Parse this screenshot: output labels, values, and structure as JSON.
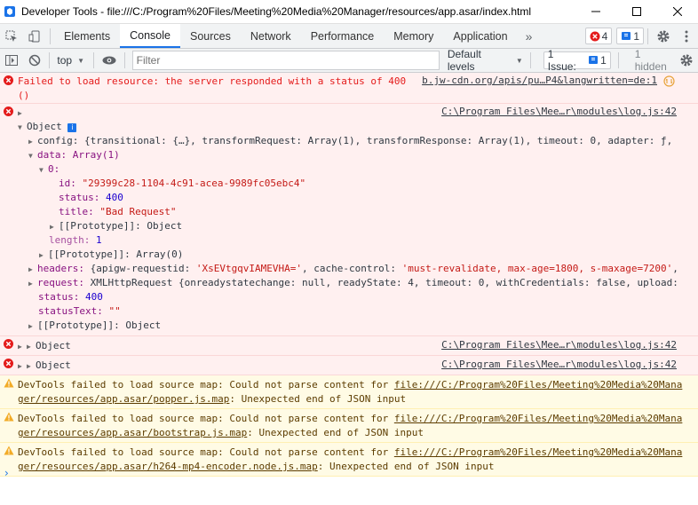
{
  "window": {
    "title": "Developer Tools - file:///C:/Program%20Files/Meeting%20Media%20Manager/resources/app.asar/index.html"
  },
  "tabs": [
    "Elements",
    "Console",
    "Sources",
    "Network",
    "Performance",
    "Memory",
    "Application"
  ],
  "badges": {
    "errors": "4",
    "info": "1"
  },
  "console_toolbar": {
    "context": "top",
    "filter_placeholder": "Filter",
    "levels": "Default levels",
    "issues_label": "1 Issue:",
    "issues_count": "1",
    "hidden": "1 hidden"
  },
  "messages": {
    "err1": {
      "text": "Failed to load resource: the server responded with a status of 400",
      "text2": "()",
      "src": "b.jw-cdn.org/apis/pu…P4&langwritten=de:1"
    },
    "err2": {
      "src": "C:\\Program Files\\Mee…r\\modules\\log.js:42",
      "obj": "Object",
      "config": "config: {transitional: {…}, transformRequest: Array(1), transformResponse: Array(1), timeout: 0, adapter: ƒ, …",
      "data": "data: Array(1)",
      "idx": "0:",
      "id_k": "id:",
      "id_v": "\"29399c28-1104-4c91-acea-9989fc05ebc4\"",
      "status_k": "status:",
      "status_v": "400",
      "title_k": "title:",
      "title_v": "\"Bad Request\"",
      "proto1": "[[Prototype]]: Object",
      "length_k": "length:",
      "length_v": "1",
      "proto2": "[[Prototype]]: Array(0)",
      "headers_k": "headers:",
      "headers_a": " {apigw-requestid: ",
      "headers_b": "'XsEVtgqvIAMEVHA='",
      "headers_c": ", cache-control: ",
      "headers_d": "'must-revalidate, max-age=1800, s-maxage=7200'",
      "headers_e": ",",
      "request_k": "request:",
      "request_v": " XMLHttpRequest {onreadystatechange: null, readyState: 4, timeout: 0, withCredentials: false, upload:",
      "status2_k": "status:",
      "status2_v": "400",
      "statustext_k": "statusText:",
      "statustext_v": "\"\"",
      "proto3": "[[Prototype]]: Object"
    },
    "err3": {
      "obj": "Object",
      "src": "C:\\Program Files\\Mee…r\\modules\\log.js:42"
    },
    "err4": {
      "obj": "Object",
      "src": "C:\\Program Files\\Mee…r\\modules\\log.js:42"
    },
    "warn1": {
      "pre": "DevTools failed to load source map: Could not parse content for ",
      "url1": "file:///C:/Program%20Files/Meeting%20Media%20Mana",
      "url2": "ger/resources/app.asar/popper.js.map",
      "post": ": Unexpected end of JSON input"
    },
    "warn2": {
      "pre": "DevTools failed to load source map: Could not parse content for ",
      "url1": "file:///C:/Program%20Files/Meeting%20Media%20Mana",
      "url2": "ger/resources/app.asar/bootstrap.js.map",
      "post": ": Unexpected end of JSON input"
    },
    "warn3": {
      "pre": "DevTools failed to load source map: Could not parse content for ",
      "url1": "file:///C:/Program%20Files/Meeting%20Media%20Mana",
      "url2": "ger/resources/app.asar/h264-mp4-encoder.node.js.map",
      "post": ": Unexpected end of JSON input"
    }
  },
  "colors": {
    "error": "#e41b1b",
    "warning": "#5c3c00",
    "accent": "#1a73e8"
  }
}
